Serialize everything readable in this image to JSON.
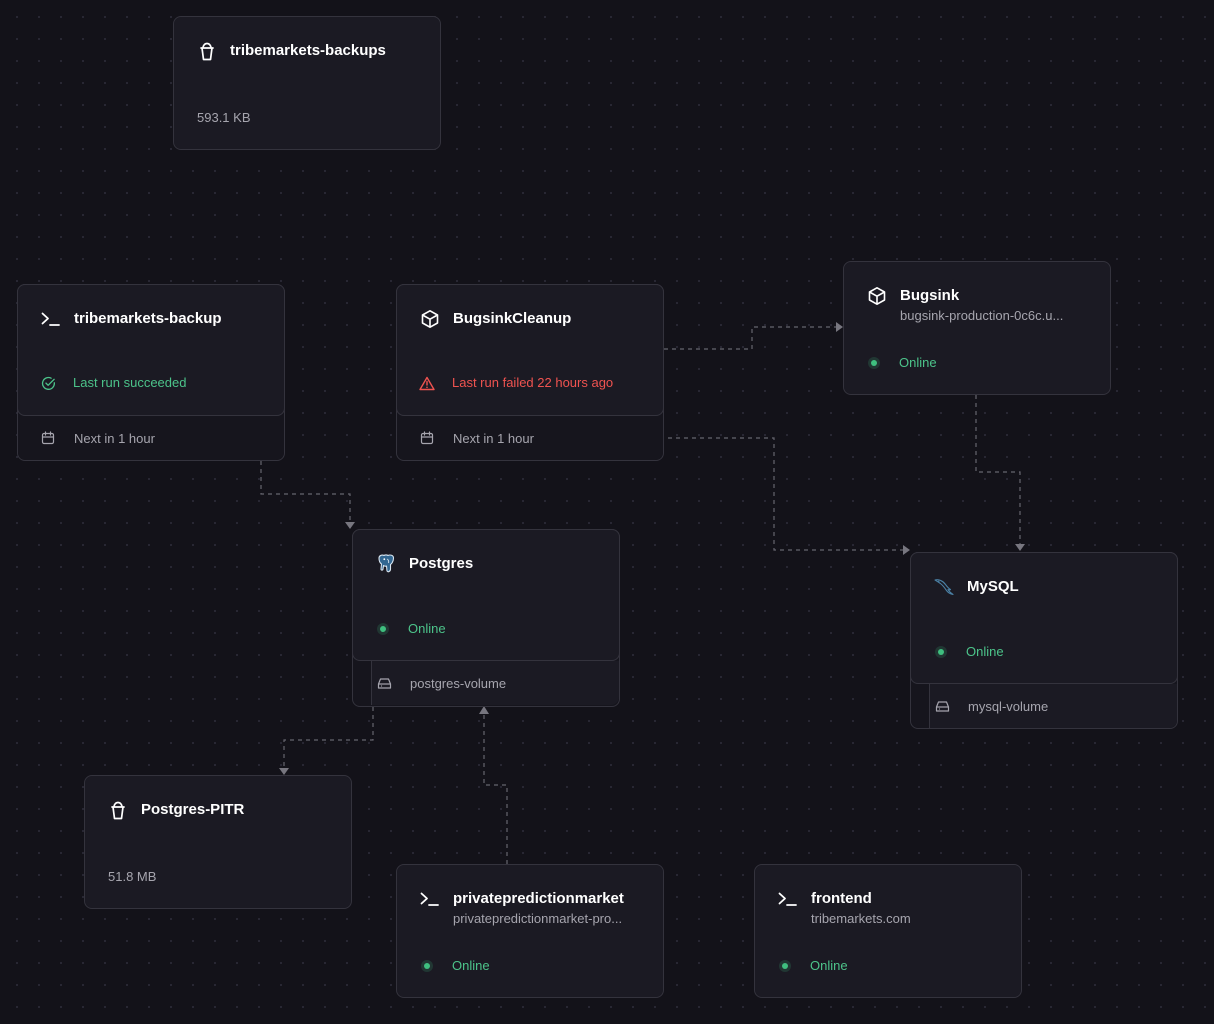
{
  "canvas": {
    "nodes": {
      "tribemarkets_backups": {
        "title": "tribemarkets-backups",
        "icon": "bucket-icon",
        "size": "593.1 KB"
      },
      "tribemarkets_backup": {
        "title": "tribemarkets-backup",
        "icon": "terminal-icon",
        "status": "Last run succeeded",
        "status_icon": "check-circle-icon",
        "schedule": "Next in 1 hour",
        "schedule_icon": "calendar-icon"
      },
      "bugsink_cleanup": {
        "title": "BugsinkCleanup",
        "icon": "cube-icon",
        "status": "Last run failed 22 hours ago",
        "status_icon": "warning-triangle-icon",
        "schedule": "Next in 1 hour",
        "schedule_icon": "calendar-icon"
      },
      "bugsink": {
        "title": "Bugsink",
        "icon": "cube-icon",
        "subtitle": "bugsink-production-0c6c.u...",
        "status": "Online"
      },
      "postgres": {
        "title": "Postgres",
        "icon": "postgres-elephant-icon",
        "status": "Online",
        "volume": "postgres-volume",
        "volume_icon": "hard-drive-icon"
      },
      "mysql": {
        "title": "MySQL",
        "icon": "mysql-dolphin-icon",
        "status": "Online",
        "volume": "mysql-volume",
        "volume_icon": "hard-drive-icon"
      },
      "postgres_pitr": {
        "title": "Postgres-PITR",
        "icon": "bucket-icon",
        "size": "51.8 MB"
      },
      "privatepredictionmarket": {
        "title": "privatepredictionmarket",
        "icon": "terminal-icon",
        "subtitle": "privatepredictionmarket-pro...",
        "status": "Online"
      },
      "frontend": {
        "title": "frontend",
        "icon": "terminal-icon",
        "subtitle": "tribemarkets.com",
        "status": "Online"
      }
    }
  },
  "colors": {
    "background": "#131219",
    "card": "#1b1a23",
    "card_border": "#34333d",
    "online": "#4cc38a",
    "failed": "#ef5350",
    "muted_text": "#a6a5ae",
    "edge": "#66656f"
  }
}
